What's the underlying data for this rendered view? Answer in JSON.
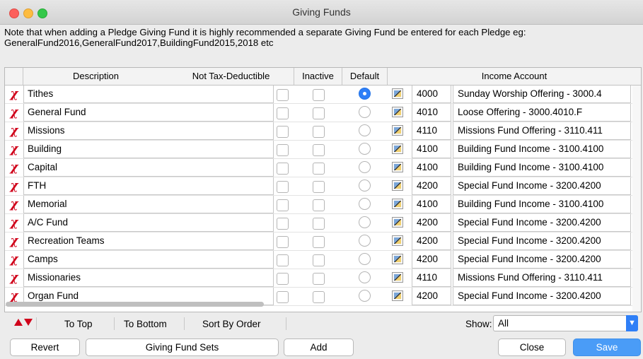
{
  "window": {
    "title": "Giving Funds"
  },
  "note": "Note that when adding a Pledge Giving Fund it is highly recommended a separate Giving Fund be entered for each Pledge eg: GeneralFund2016,GeneralFund2017,BuildingFund2015,2018 etc",
  "columns": {
    "description": "Description",
    "not_tax_deductible": "Not Tax-Deductible",
    "inactive": "Inactive",
    "default": "Default",
    "income_account": "Income Account"
  },
  "rows": [
    {
      "description": "Tithes",
      "account": "4000",
      "account_name": "Sunday Worship Offering - 3000.4",
      "default": true
    },
    {
      "description": "General Fund",
      "account": "4010",
      "account_name": "Loose Offering - 3000.4010.F",
      "default": false
    },
    {
      "description": "Missions",
      "account": "4110",
      "account_name": "Missions Fund Offering - 3110.411",
      "default": false
    },
    {
      "description": "Building",
      "account": "4100",
      "account_name": "Building Fund Income - 3100.4100",
      "default": false
    },
    {
      "description": "Capital",
      "account": "4100",
      "account_name": "Building Fund Income - 3100.4100",
      "default": false
    },
    {
      "description": "FTH",
      "account": "4200",
      "account_name": "Special Fund Income - 3200.4200",
      "default": false
    },
    {
      "description": "Memorial",
      "account": "4100",
      "account_name": "Building Fund Income - 3100.4100",
      "default": false
    },
    {
      "description": "A/C Fund",
      "account": "4200",
      "account_name": "Special Fund Income - 3200.4200",
      "default": false
    },
    {
      "description": "Recreation Teams",
      "account": "4200",
      "account_name": "Special Fund Income - 3200.4200",
      "default": false
    },
    {
      "description": "Camps",
      "account": "4200",
      "account_name": "Special Fund Income - 3200.4200",
      "default": false
    },
    {
      "description": "Missionaries",
      "account": "4110",
      "account_name": "Missions Fund Offering - 3110.411",
      "default": false
    },
    {
      "description": "Organ Fund",
      "account": "4200",
      "account_name": "Special Fund Income - 3200.4200",
      "default": false
    }
  ],
  "toolbar": {
    "to_top": "To Top",
    "to_bottom": "To Bottom",
    "sort_by_order": "Sort By Order",
    "show_label": "Show:",
    "show_value": "All"
  },
  "buttons": {
    "revert": "Revert",
    "giving_fund_sets": "Giving Fund Sets",
    "add": "Add",
    "close": "Close",
    "save": "Save"
  },
  "icons": {
    "delete": "delete-x-icon",
    "move_up": "arrow-up-icon",
    "move_down": "arrow-down-icon",
    "account_picker": "account-picker-icon"
  },
  "colors": {
    "accent": "#2f7ff7",
    "delete": "#d0021b",
    "save_button": "#4a9cf7"
  }
}
